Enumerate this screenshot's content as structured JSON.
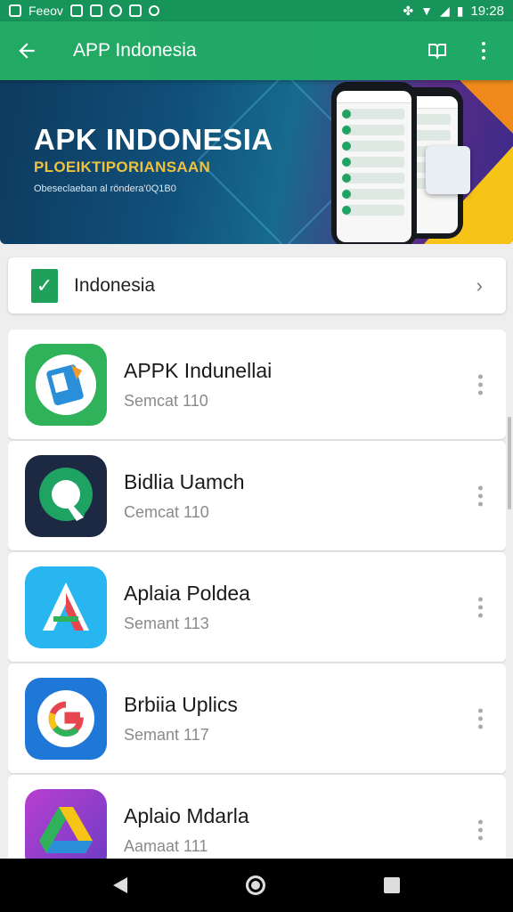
{
  "status_bar": {
    "left_label": "Feeov",
    "time": "19:28"
  },
  "app_bar": {
    "title": "APP Indonesia"
  },
  "banner": {
    "title": "APK INDONESIA",
    "subtitle": "PLOEIKTIPORIANSAAN",
    "small_text": "Obeseclaeban al röndera'0Q1B0"
  },
  "category": {
    "label": "Indonesia"
  },
  "apps": [
    {
      "name": "APPK Indunellai",
      "sub": "Semcat 110",
      "icon": "book-icon",
      "color": "#2fb25a"
    },
    {
      "name": "Bidlia Uamch",
      "sub": "Cemcat 110",
      "icon": "q-icon",
      "color": "#1d2942"
    },
    {
      "name": "Aplaia Poldea",
      "sub": "Semant 113",
      "icon": "a-icon",
      "color": "#27b6ef"
    },
    {
      "name": "Brbiia Uplics",
      "sub": "Semant 117",
      "icon": "g-icon",
      "color": "#1f78d8"
    },
    {
      "name": "Aplaio Mdarla",
      "sub": "Aamaat 111",
      "icon": "drive-icon",
      "color": "#8e3fc9"
    }
  ]
}
